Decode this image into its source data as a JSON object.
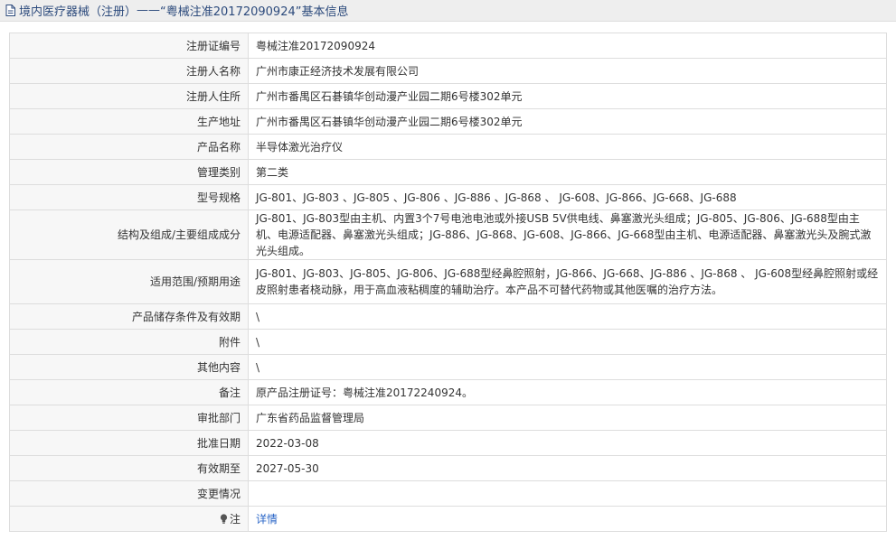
{
  "header": {
    "title_left": "境内医疗器械（注册）",
    "title_dash": " ——",
    "title_right": "“粤械注准20172090924”基本信息",
    "icon": "document-icon"
  },
  "rows": [
    {
      "label": "注册证编号",
      "value": "粤械注准20172090924"
    },
    {
      "label": "注册人名称",
      "value": "广州市康正经济技术发展有限公司"
    },
    {
      "label": "注册人住所",
      "value": "广州市番禺区石碁镇华创动漫产业园二期6号楼302单元"
    },
    {
      "label": "生产地址",
      "value": "广州市番禺区石碁镇华创动漫产业园二期6号楼302单元"
    },
    {
      "label": "产品名称",
      "value": "半导体激光治疗仪"
    },
    {
      "label": "管理类别",
      "value": "第二类"
    },
    {
      "label": "型号规格",
      "value": "JG-801、JG-803 、JG-805 、JG-806 、JG-886 、JG-868 、 JG-608、JG-866、JG-668、JG-688"
    },
    {
      "label": "结构及组成/主要组成成分",
      "value": "JG-801、JG-803型由主机、内置3个7号电池电池或外接USB 5V供电线、鼻塞激光头组成；JG-805、JG-806、JG-688型由主机、电源适配器、鼻塞激光头组成；JG-886、JG-868、JG-608、JG-866、JG-668型由主机、电源适配器、鼻塞激光头及腕式激光头组成。"
    },
    {
      "label": "适用范围/预期用途",
      "value": "JG-801、JG-803、JG-805、JG-806、JG-688型经鼻腔照射，JG-866、JG-668、JG-886 、JG-868 、 JG-608型经鼻腔照射或经皮照射患者桡动脉，用于高血液粘稠度的辅助治疗。本产品不可替代药物或其他医嘱的治疗方法。"
    },
    {
      "label": "产品储存条件及有效期",
      "value": "\\"
    },
    {
      "label": "附件",
      "value": "\\"
    },
    {
      "label": "其他内容",
      "value": "\\"
    },
    {
      "label": "备注",
      "value": "原产品注册证号：粤械注准20172240924。"
    },
    {
      "label": "审批部门",
      "value": "广东省药品监督管理局"
    },
    {
      "label": "批准日期",
      "value": "2022-03-08"
    },
    {
      "label": "有效期至",
      "value": "2027-05-30"
    },
    {
      "label": "变更情况",
      "value": ""
    }
  ],
  "note": {
    "label": "注",
    "icon": "lightbulb-icon",
    "link_text": "详情"
  },
  "colors": {
    "header_bg": "#eeeeee",
    "label_bg": "#f7f7f7",
    "border": "#dddddd",
    "link": "#2a66c7",
    "title": "#2c4a7c"
  }
}
